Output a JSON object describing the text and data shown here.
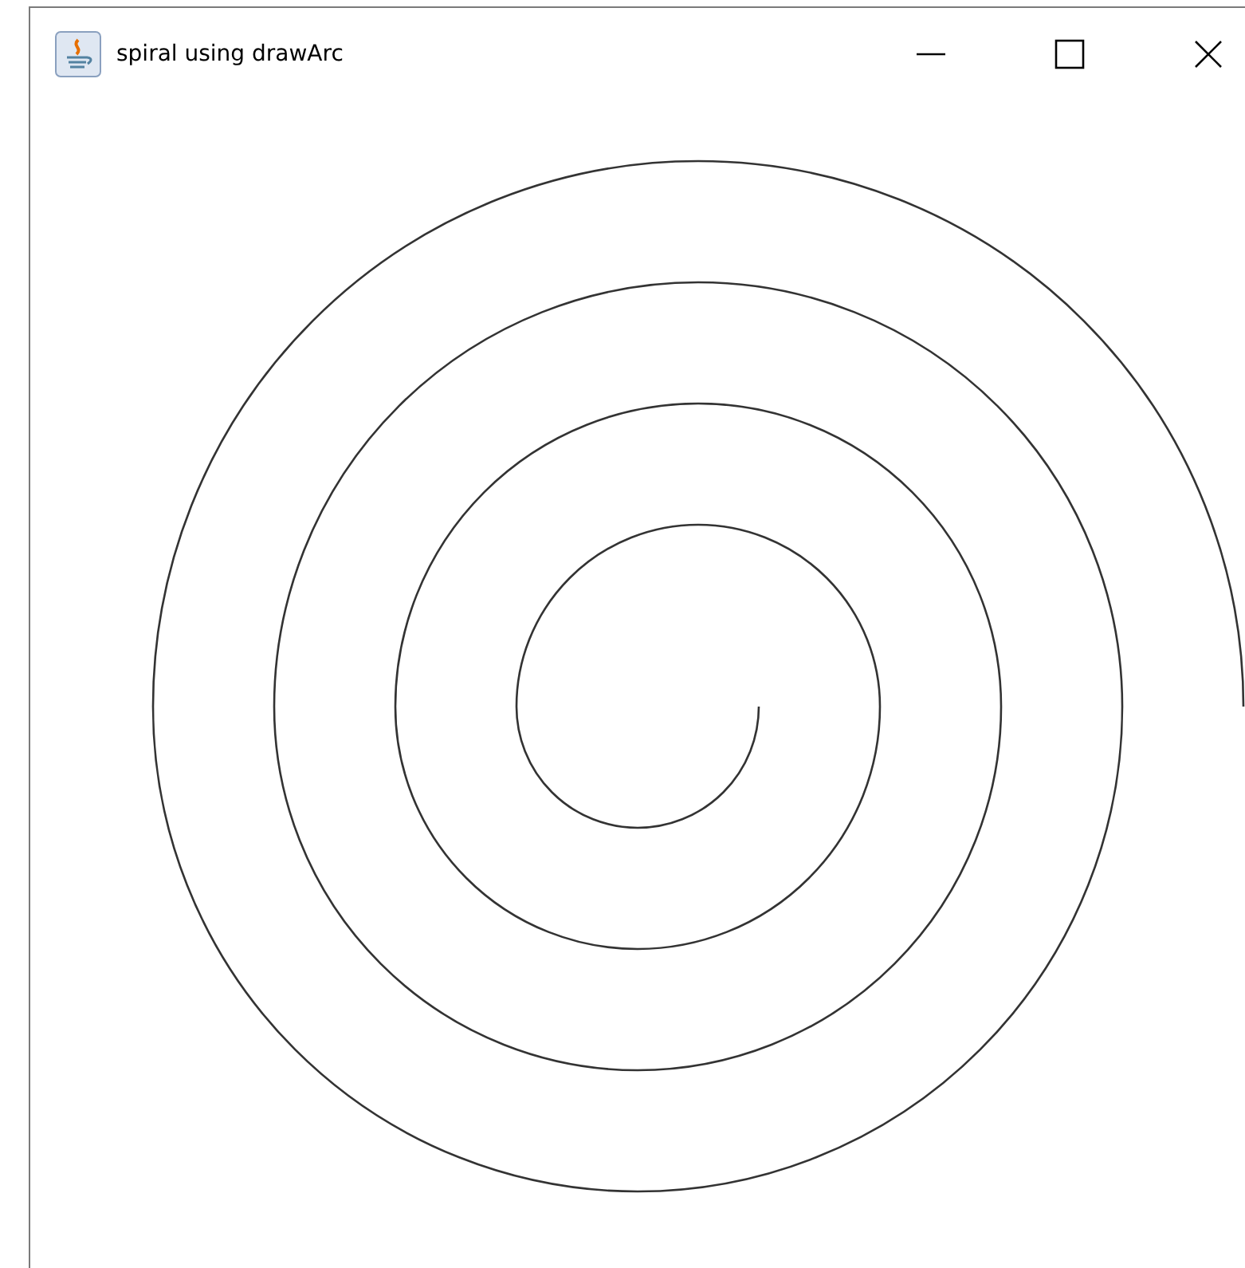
{
  "window": {
    "title": "spiral using drawArc"
  }
}
